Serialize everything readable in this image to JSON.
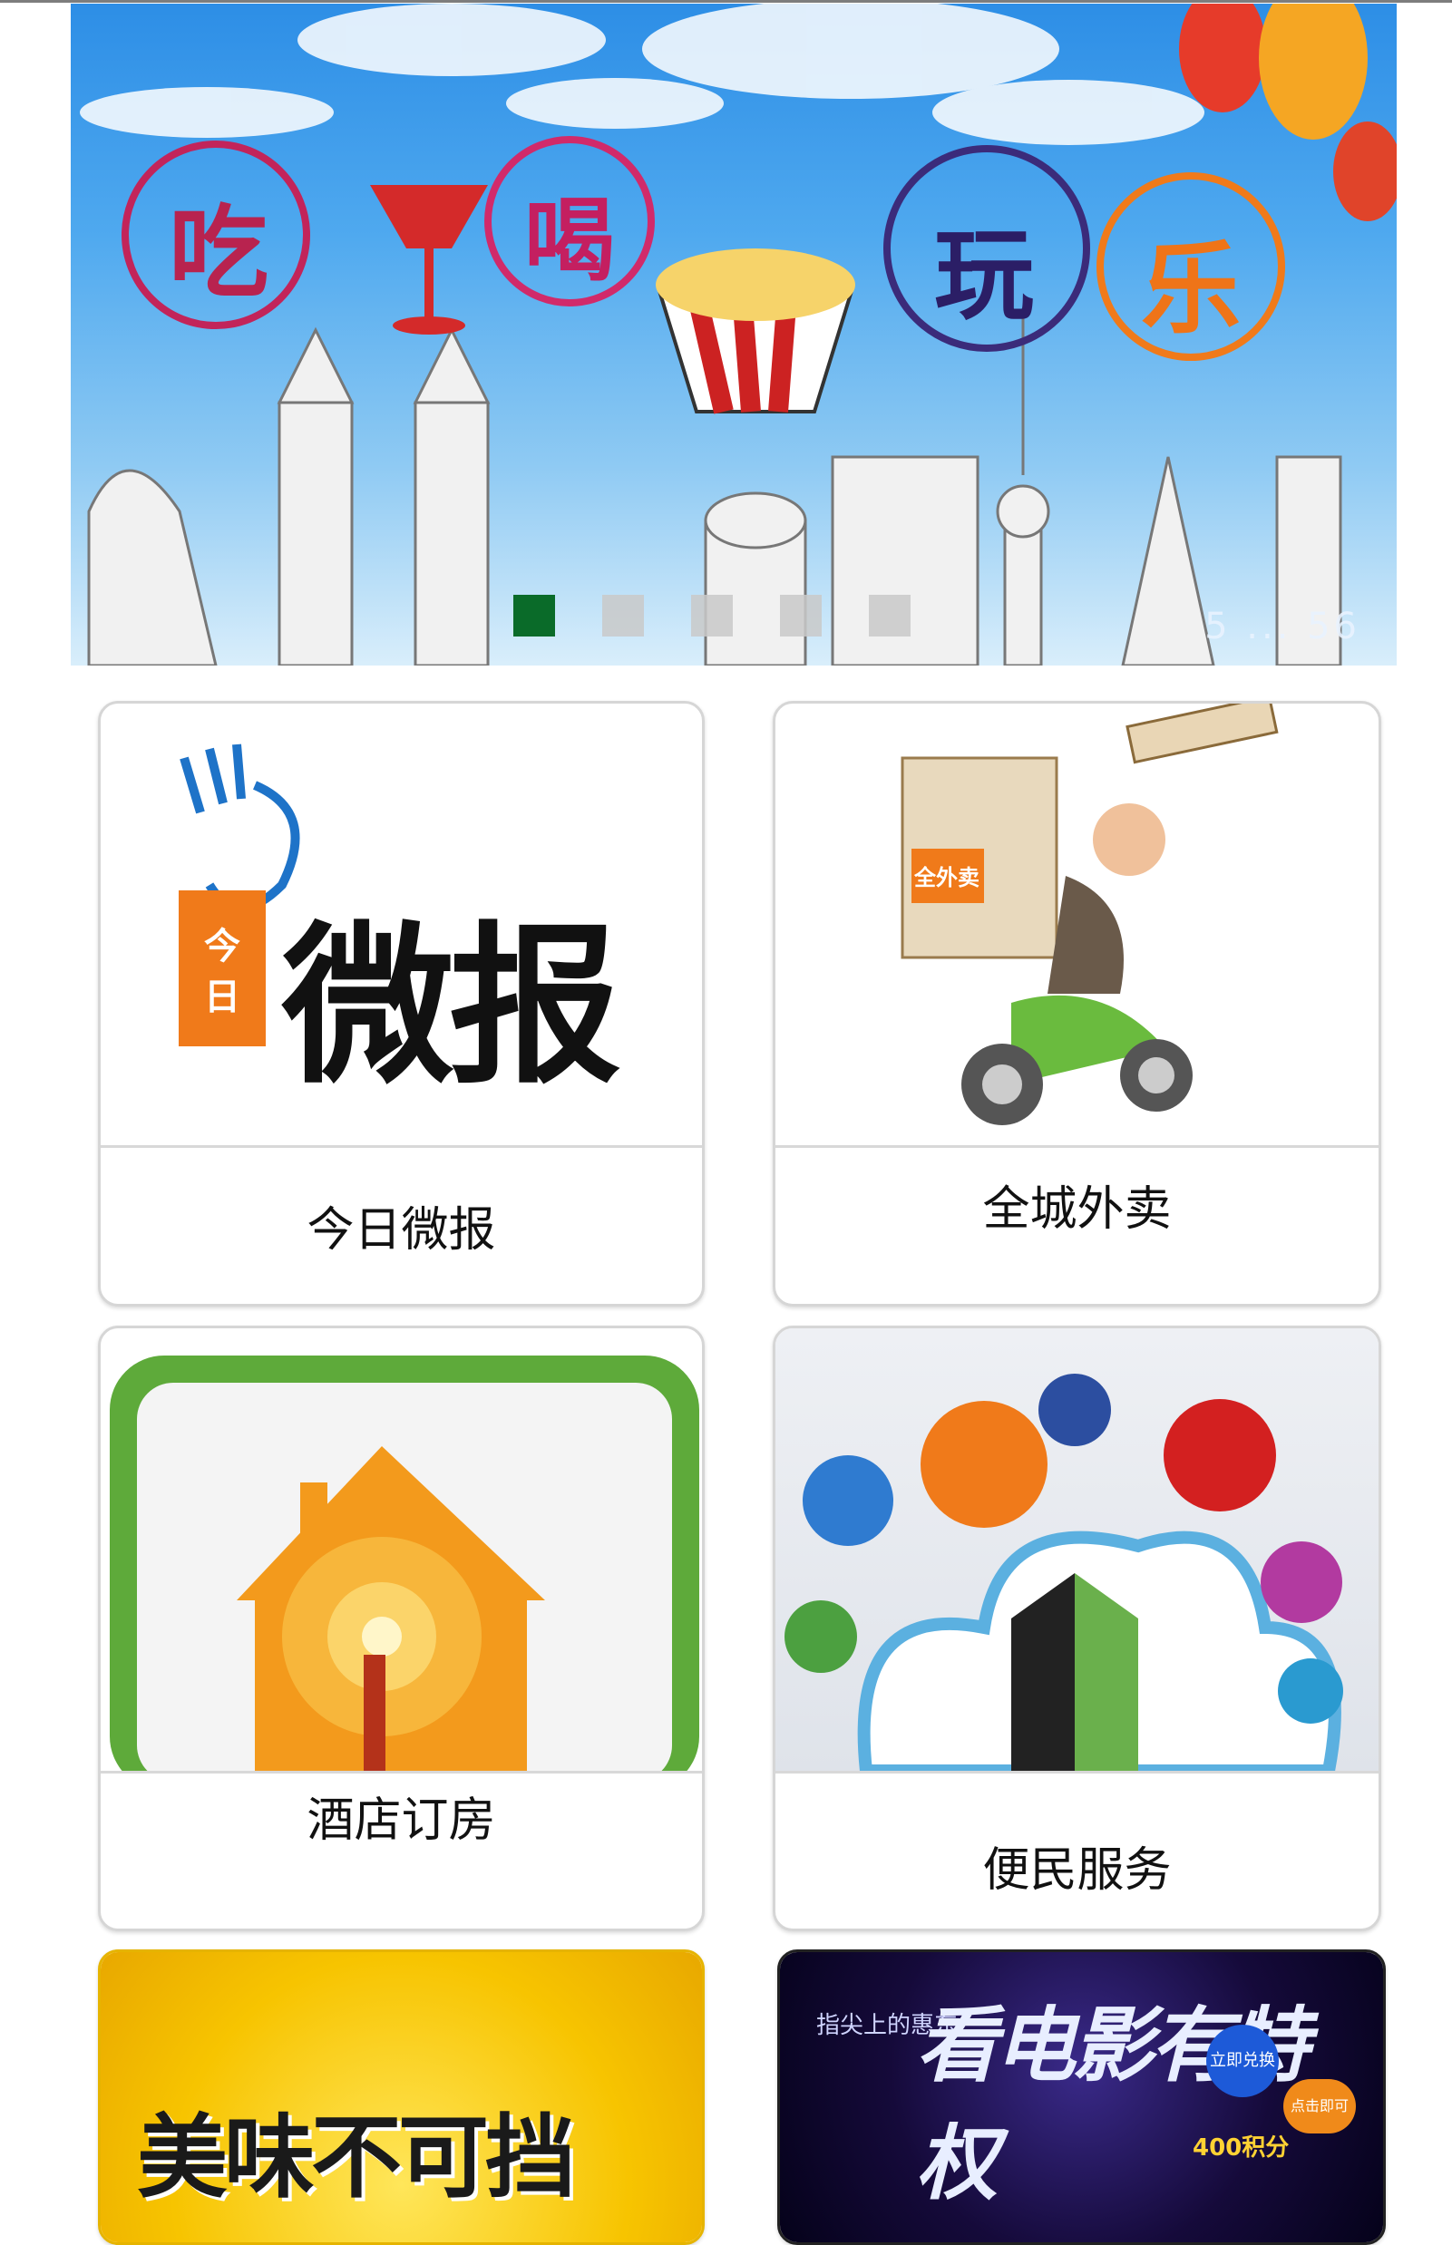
{
  "banner": {
    "headline_chars": [
      "吃",
      "喝",
      "玩",
      "乐"
    ],
    "slide_count": 5,
    "active_slide": 1,
    "sign_text": "5 ... 56"
  },
  "tiles": [
    {
      "label": "今日微报",
      "logo_text": "微报",
      "logo_box_text": "今日"
    },
    {
      "label": "全城外卖",
      "badge_text": "全外卖"
    },
    {
      "label": "酒店订房"
    },
    {
      "label": "便民服务"
    },
    {
      "headline": "美味不可挡"
    },
    {
      "headline": "看电影有特权",
      "subline": "指尖上的惠东",
      "points": "400积分",
      "badge1": "立即兑换",
      "badge2": "点击即可"
    }
  ],
  "colors": {
    "accent_orange": "#f07a1a",
    "logo_blue": "#1e73c8",
    "active_dot": "#0a6b29",
    "tile_border": "#d6d6d6"
  }
}
